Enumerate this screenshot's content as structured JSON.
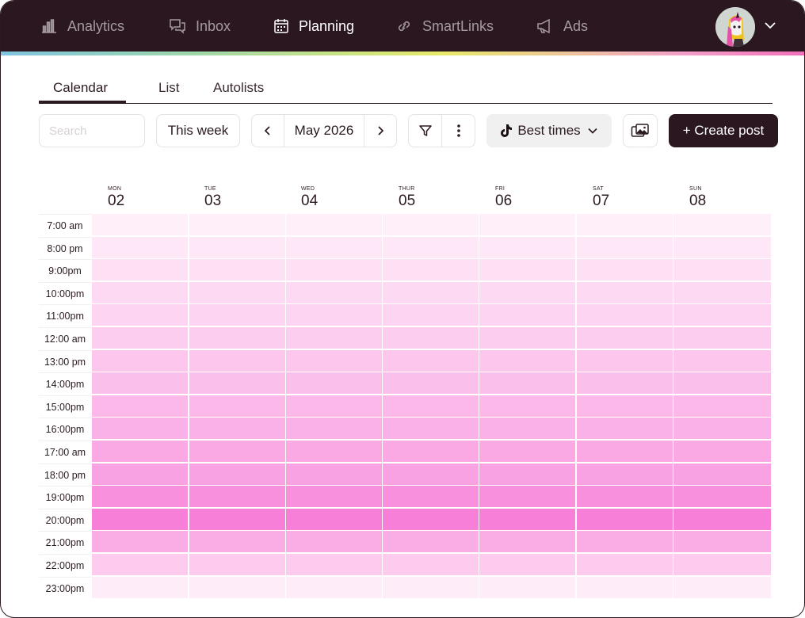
{
  "nav": {
    "items": [
      {
        "label": "Analytics",
        "icon": "bar-chart-icon",
        "active": false
      },
      {
        "label": "Inbox",
        "icon": "chat-bubbles-icon",
        "active": false
      },
      {
        "label": "Planning",
        "icon": "calendar-icon",
        "active": true
      },
      {
        "label": "SmartLinks",
        "icon": "link-icon",
        "active": false
      },
      {
        "label": "Ads",
        "icon": "megaphone-icon",
        "active": false
      }
    ]
  },
  "tabs": {
    "calendar": "Calendar",
    "list": "List",
    "autolists": "Autolists"
  },
  "toolbar": {
    "search_placeholder": "Search",
    "week_label": "This week",
    "month_label": "May 2026",
    "best_times_label": "Best times",
    "create_label": "+ Create post"
  },
  "days": [
    {
      "name": "MON",
      "num": "02"
    },
    {
      "name": "TUE",
      "num": "03"
    },
    {
      "name": "WED",
      "num": "04"
    },
    {
      "name": "THUR",
      "num": "05"
    },
    {
      "name": "FRI",
      "num": "06"
    },
    {
      "name": "SAT",
      "num": "07"
    },
    {
      "name": "SUN",
      "num": "08"
    }
  ],
  "times": [
    "7:00 am",
    "8:00 pm",
    "9:00pm",
    "10:00pm",
    "11:00pm",
    "12:00 am",
    "13:00 pm",
    "14:00pm",
    "15:00pm",
    "16:00pm",
    "17:00 am",
    "18:00 pm",
    "19:00pm",
    "20:00pm",
    "21:00pm",
    "22:00pm",
    "23:00pm"
  ],
  "heat_levels": [
    0.05,
    0.12,
    0.18,
    0.24,
    0.28,
    0.34,
    0.4,
    0.46,
    0.52,
    0.58,
    0.64,
    0.7,
    0.86,
    1.0,
    0.62,
    0.36,
    0.08
  ],
  "colors": {
    "topbar": "#2b1720",
    "heat_low": "#fff5fb",
    "heat_high": "#f77fd8",
    "accent": "#2b1720"
  }
}
